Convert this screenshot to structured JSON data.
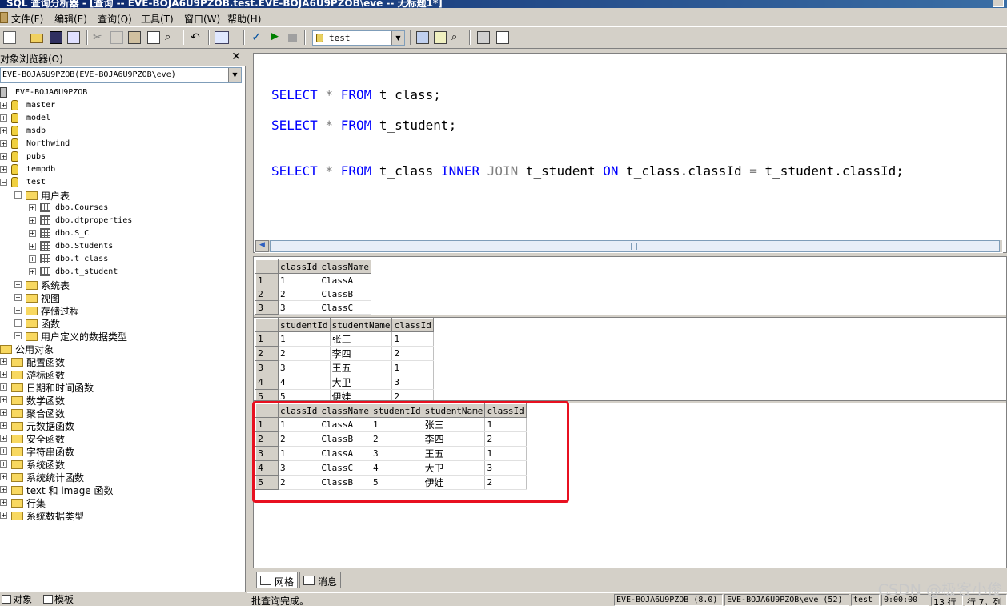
{
  "window": {
    "title": "SQL 查询分析器 - [查询 -- EVE-BOJA6U9PZOB.test.EVE-BOJA6U9PZOB\\eve -- 无标题1*]"
  },
  "menu": [
    "文件(F)",
    "编辑(E)",
    "查询(Q)",
    "工具(T)",
    "窗口(W)",
    "帮助(H)"
  ],
  "toolbar": {
    "database": "test",
    "icons": [
      "new-query-icon",
      "open-icon",
      "save-icon",
      "load-script-icon",
      "cut-icon",
      "copy-icon",
      "paste-icon",
      "clear-icon",
      "find-icon",
      "undo-icon",
      "results-mode-icon",
      "parse-icon",
      "execute-icon",
      "stop-icon",
      "object-browser-icon",
      "object-search-icon",
      "options-icon",
      "show-results-icon"
    ]
  },
  "object_browser": {
    "title": "对象浏览器(O)",
    "close": "✕",
    "server_select": "EVE-BOJA6U9PZOB(EVE-BOJA6U9PZOB\\eve)",
    "server_root": "EVE-BOJA6U9PZOB",
    "databases": [
      "master",
      "model",
      "msdb",
      "Northwind",
      "pubs",
      "tempdb",
      "test"
    ],
    "user_tables_folder": "用户表",
    "user_tables": [
      "dbo.Courses",
      "dbo.dtproperties",
      "dbo.S_C",
      "dbo.Students",
      "dbo.t_class",
      "dbo.t_student"
    ],
    "test_folders": [
      "系统表",
      "视图",
      "存储过程",
      "函数",
      "用户定义的数据类型"
    ],
    "public_objects": "公用对象",
    "public_folders": [
      "配置函数",
      "游标函数",
      "日期和时间函数",
      "数学函数",
      "聚合函数",
      "元数据函数",
      "安全函数",
      "字符串函数",
      "系统函数",
      "系统统计函数",
      "text 和 image 函数",
      "行集",
      "系统数据类型"
    ],
    "tabs": [
      "对象",
      "模板"
    ]
  },
  "editor": {
    "lines": [
      {
        "parts": [
          [
            "kw",
            "SELECT"
          ],
          [
            "op",
            " * "
          ],
          [
            "kw",
            "FROM"
          ],
          [
            "id",
            " t_class;"
          ]
        ]
      },
      {
        "parts": [
          [
            "kw",
            "SELECT"
          ],
          [
            "op",
            " * "
          ],
          [
            "kw",
            "FROM"
          ],
          [
            "id",
            " t_student;"
          ]
        ]
      },
      {
        "parts": [
          [
            "kw",
            "SELECT"
          ],
          [
            "op",
            " * "
          ],
          [
            "kw",
            "FROM"
          ],
          [
            "id",
            " t_class "
          ],
          [
            "kw",
            "INNER"
          ],
          [
            "op",
            " JOIN "
          ],
          [
            "id",
            "t_student "
          ],
          [
            "kw",
            "ON"
          ],
          [
            "id",
            " t_class.classId "
          ],
          [
            "op",
            "="
          ],
          [
            "id",
            " t_student.classId;"
          ]
        ]
      }
    ]
  },
  "results": {
    "grids": [
      {
        "columns": [
          "classId",
          "className"
        ],
        "rows": [
          [
            "1",
            "ClassA"
          ],
          [
            "2",
            "ClassB"
          ],
          [
            "3",
            "ClassC"
          ]
        ]
      },
      {
        "columns": [
          "studentId",
          "studentName",
          "classId"
        ],
        "rows": [
          [
            "1",
            "张三",
            "1"
          ],
          [
            "2",
            "李四",
            "2"
          ],
          [
            "3",
            "王五",
            "1"
          ],
          [
            "4",
            "大卫",
            "3"
          ],
          [
            "5",
            "伊娃",
            "2"
          ]
        ]
      },
      {
        "columns": [
          "classId",
          "className",
          "studentId",
          "studentName",
          "classId"
        ],
        "rows": [
          [
            "1",
            "ClassA",
            "1",
            "张三",
            "1"
          ],
          [
            "2",
            "ClassB",
            "2",
            "李四",
            "2"
          ],
          [
            "1",
            "ClassA",
            "3",
            "王五",
            "1"
          ],
          [
            "3",
            "ClassC",
            "4",
            "大卫",
            "3"
          ],
          [
            "2",
            "ClassB",
            "5",
            "伊娃",
            "2"
          ]
        ]
      }
    ],
    "tabs": [
      "网格",
      "消息"
    ]
  },
  "status": {
    "message": "批查询完成。",
    "server": "EVE-BOJA6U9PZOB (8.0)",
    "user": "EVE-BOJA6U9PZOB\\eve (52)",
    "database": "test",
    "elapsed": "0:00:00",
    "rows": "13 行",
    "position": "行 7，列"
  },
  "watermark": "CSDN @极客小俊",
  "colors": {
    "keyword": "#0000ff",
    "highlight": "#e81020"
  }
}
